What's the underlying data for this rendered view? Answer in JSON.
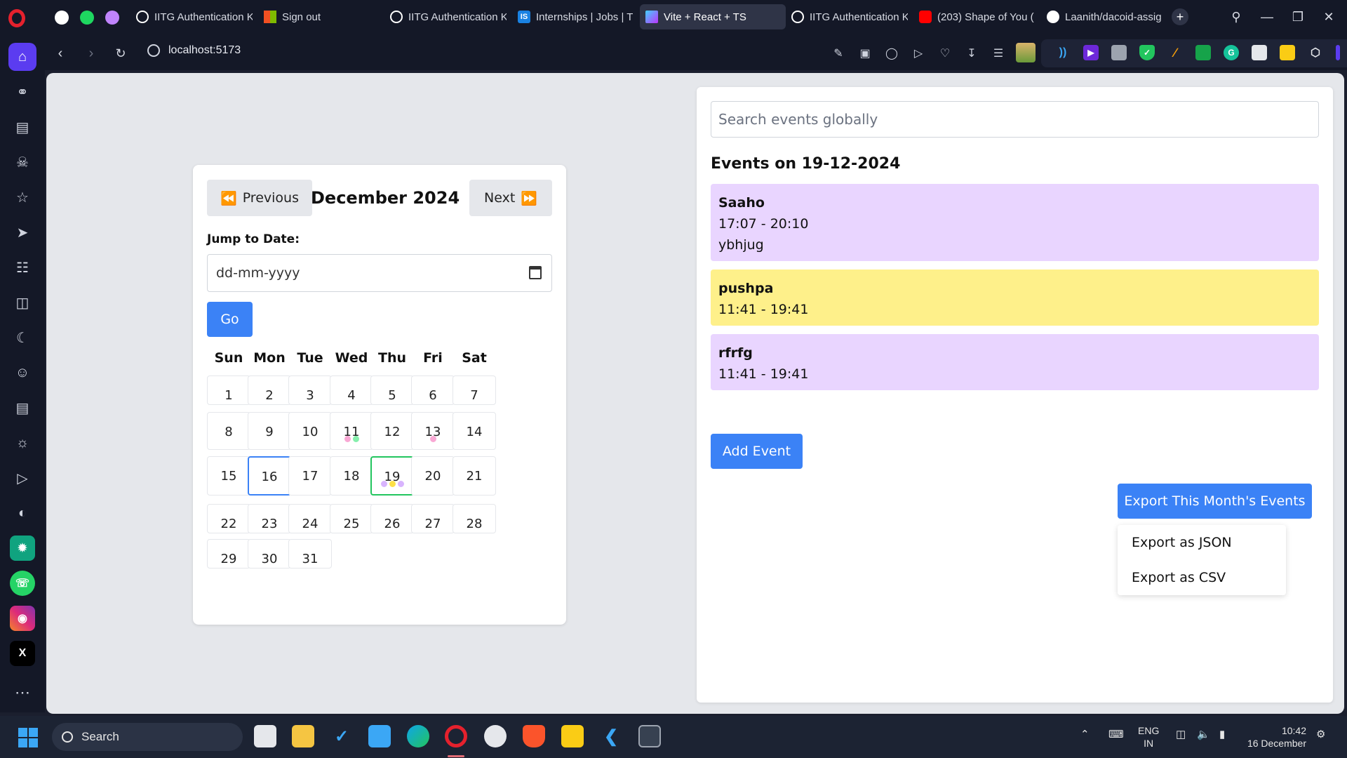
{
  "browser": {
    "tabs": [
      {
        "label": "IITG Authentication K",
        "fav": "globe-icon",
        "color": "#ffffff"
      },
      {
        "label": "Sign out",
        "fav": "microsoft-icon",
        "color": "#f25022"
      },
      {
        "label": "IITG Authentication K",
        "fav": "globe-icon",
        "color": "#ffffff"
      },
      {
        "label": "Internships | Jobs | Tra",
        "fav": "is-icon",
        "color": "#1a82e2"
      },
      {
        "label": "Vite + React + TS",
        "fav": "vite-icon",
        "color": "#a66cff"
      },
      {
        "label": "IITG Authentication K",
        "fav": "globe-icon",
        "color": "#ffffff"
      },
      {
        "label": "(203) Shape of You (",
        "fav": "youtube-icon",
        "color": "#ff0000"
      },
      {
        "label": "Laanith/dacoid-assign",
        "fav": "github-icon",
        "color": "#ffffff"
      }
    ],
    "url": "localhost:5173"
  },
  "app": {
    "calendar": {
      "prev_label": "Previous",
      "next_label": "Next",
      "month_title": "December 2024",
      "jump_label": "Jump to Date:",
      "date_placeholder": "dd-mm-yyyy",
      "go_label": "Go",
      "weekdays": [
        "Sun",
        "Mon",
        "Tue",
        "Wed",
        "Thu",
        "Fri",
        "Sat"
      ],
      "days": [
        "1",
        "2",
        "3",
        "4",
        "5",
        "6",
        "7",
        "8",
        "9",
        "10",
        "11",
        "12",
        "13",
        "14",
        "15",
        "16",
        "17",
        "18",
        "19",
        "20",
        "21",
        "22",
        "23",
        "24",
        "25",
        "26",
        "27",
        "28",
        "29",
        "30",
        "31"
      ],
      "today": "16",
      "selected": "19",
      "event_dots": {
        "11": [
          "#f9a8d4",
          "#86efac"
        ],
        "13": [
          "#f9a8d4"
        ],
        "19": [
          "#d8b4fe",
          "#fde047",
          "#d8b4fe"
        ]
      }
    },
    "events": {
      "search_placeholder": "Search events globally",
      "heading": "Events on 19-12-2024",
      "items": [
        {
          "title": "Saaho",
          "time": "17:07 - 20:10",
          "description": "ybhjug",
          "color": "#e9d5ff"
        },
        {
          "title": "pushpa",
          "time": "11:41 - 19:41",
          "description": "",
          "color": "#fef08a"
        },
        {
          "title": "rfrfg",
          "time": "11:41 - 19:41",
          "description": "",
          "color": "#e9d5ff"
        }
      ],
      "add_label": "Add Event",
      "export_label": "Export This Month's Events",
      "export_json": "Export as JSON",
      "export_csv": "Export as CSV"
    }
  },
  "taskbar": {
    "search_label": "Search",
    "lang_line1": "ENG",
    "lang_line2": "IN",
    "time": "10:42",
    "date": "16 December"
  },
  "colors": {
    "accent": "#3b82f6",
    "today_border": "#3b82f6",
    "selected_border": "#22c55e",
    "opera_red": "#e5212d"
  }
}
